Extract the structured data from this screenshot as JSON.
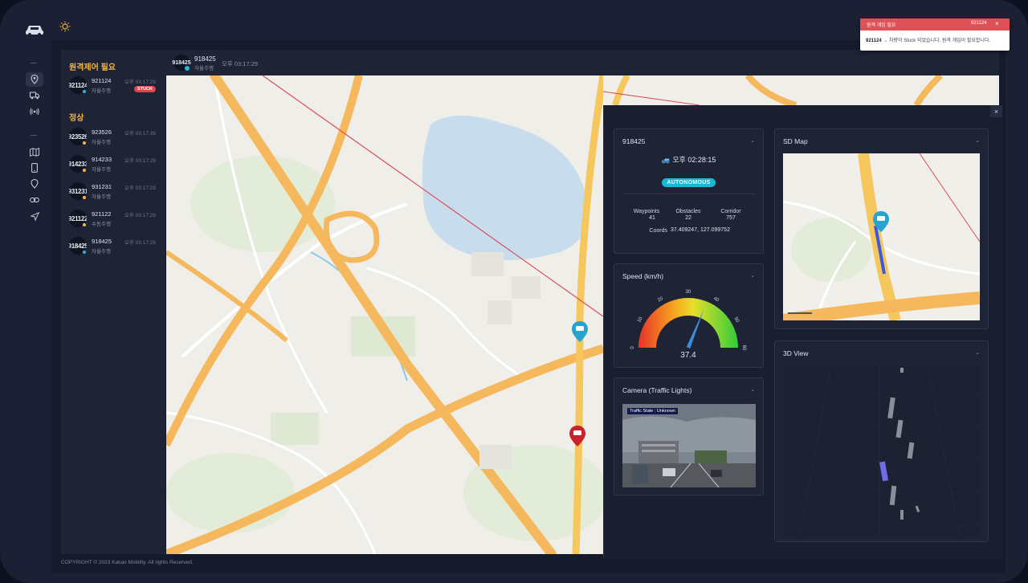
{
  "colors": {
    "accent": "#31b5d6",
    "warning": "#f4b73f",
    "danger": "#e0454f",
    "background": "#1b2034"
  },
  "sidebar": {
    "icons": [
      "car-logo-icon",
      "sun-icon",
      "location-pin-icon",
      "truck-icon",
      "broadcast-icon",
      "map-icon",
      "mobile-icon",
      "pin-icon",
      "link-icon",
      "send-icon"
    ]
  },
  "vehicles": {
    "remote_title": "원격제어 필요",
    "normal_title": "정상",
    "remote": [
      {
        "avatar": "921124",
        "id": "921124",
        "mode": "자율주행",
        "time": "오후 03:17:29",
        "badge": "STUCK"
      }
    ],
    "normal": [
      {
        "avatar": "923526",
        "id": "923526",
        "mode": "자율주행",
        "time": "오후 03:17:39"
      },
      {
        "avatar": "914233",
        "id": "914233",
        "mode": "자율주행",
        "time": "오후 03:17:29"
      },
      {
        "avatar": "931231",
        "id": "931231",
        "mode": "자율주행",
        "time": "오후 03:17:29"
      },
      {
        "avatar": "921122",
        "id": "921122",
        "mode": "수동주행",
        "time": "오후 03:17:29"
      },
      {
        "avatar": "918425",
        "id": "918425",
        "mode": "자율주행",
        "time": "오후 03:17:29"
      }
    ]
  },
  "map_header": {
    "avatar": "918425",
    "id": "918425",
    "mode": "자율주행",
    "time": "오후 03:17:29"
  },
  "detail": {
    "close": "×",
    "info": {
      "title": "918425",
      "time": "오후 02:28:15",
      "status": "AUTONOMOUS",
      "waypoints_label": "Waypoints",
      "waypoints": "41",
      "obstacles_label": "Obstacles",
      "obstacles": "22",
      "corridor_label": "Corridor",
      "corridor": "757",
      "coords_label": "Coords",
      "coords": "37.409247, 127.099752"
    },
    "speed": {
      "title": "Speed (km/h)",
      "value": 37.4,
      "value_text": "37.4",
      "min": 0,
      "max": 60,
      "ticks": [
        "0",
        "10",
        "20",
        "30",
        "40",
        "50",
        "60"
      ]
    },
    "camera": {
      "title": "Camera (Traffic Lights)",
      "overlay": "Traffic State : Unknown"
    },
    "sdmap": {
      "title": "SD Map"
    },
    "view3d": {
      "title": "3D View"
    }
  },
  "toast": {
    "title": "원격 개입 필요",
    "id": "921124",
    "close": "×",
    "vehicle": "921124",
    "message": "→ 차량이 Stuck 되었습니다. 원격 개입이 필요합니다."
  },
  "footer": {
    "copyright": "COPYRIGHT © 2023 Kakao Mobility. All rights Reserved."
  }
}
